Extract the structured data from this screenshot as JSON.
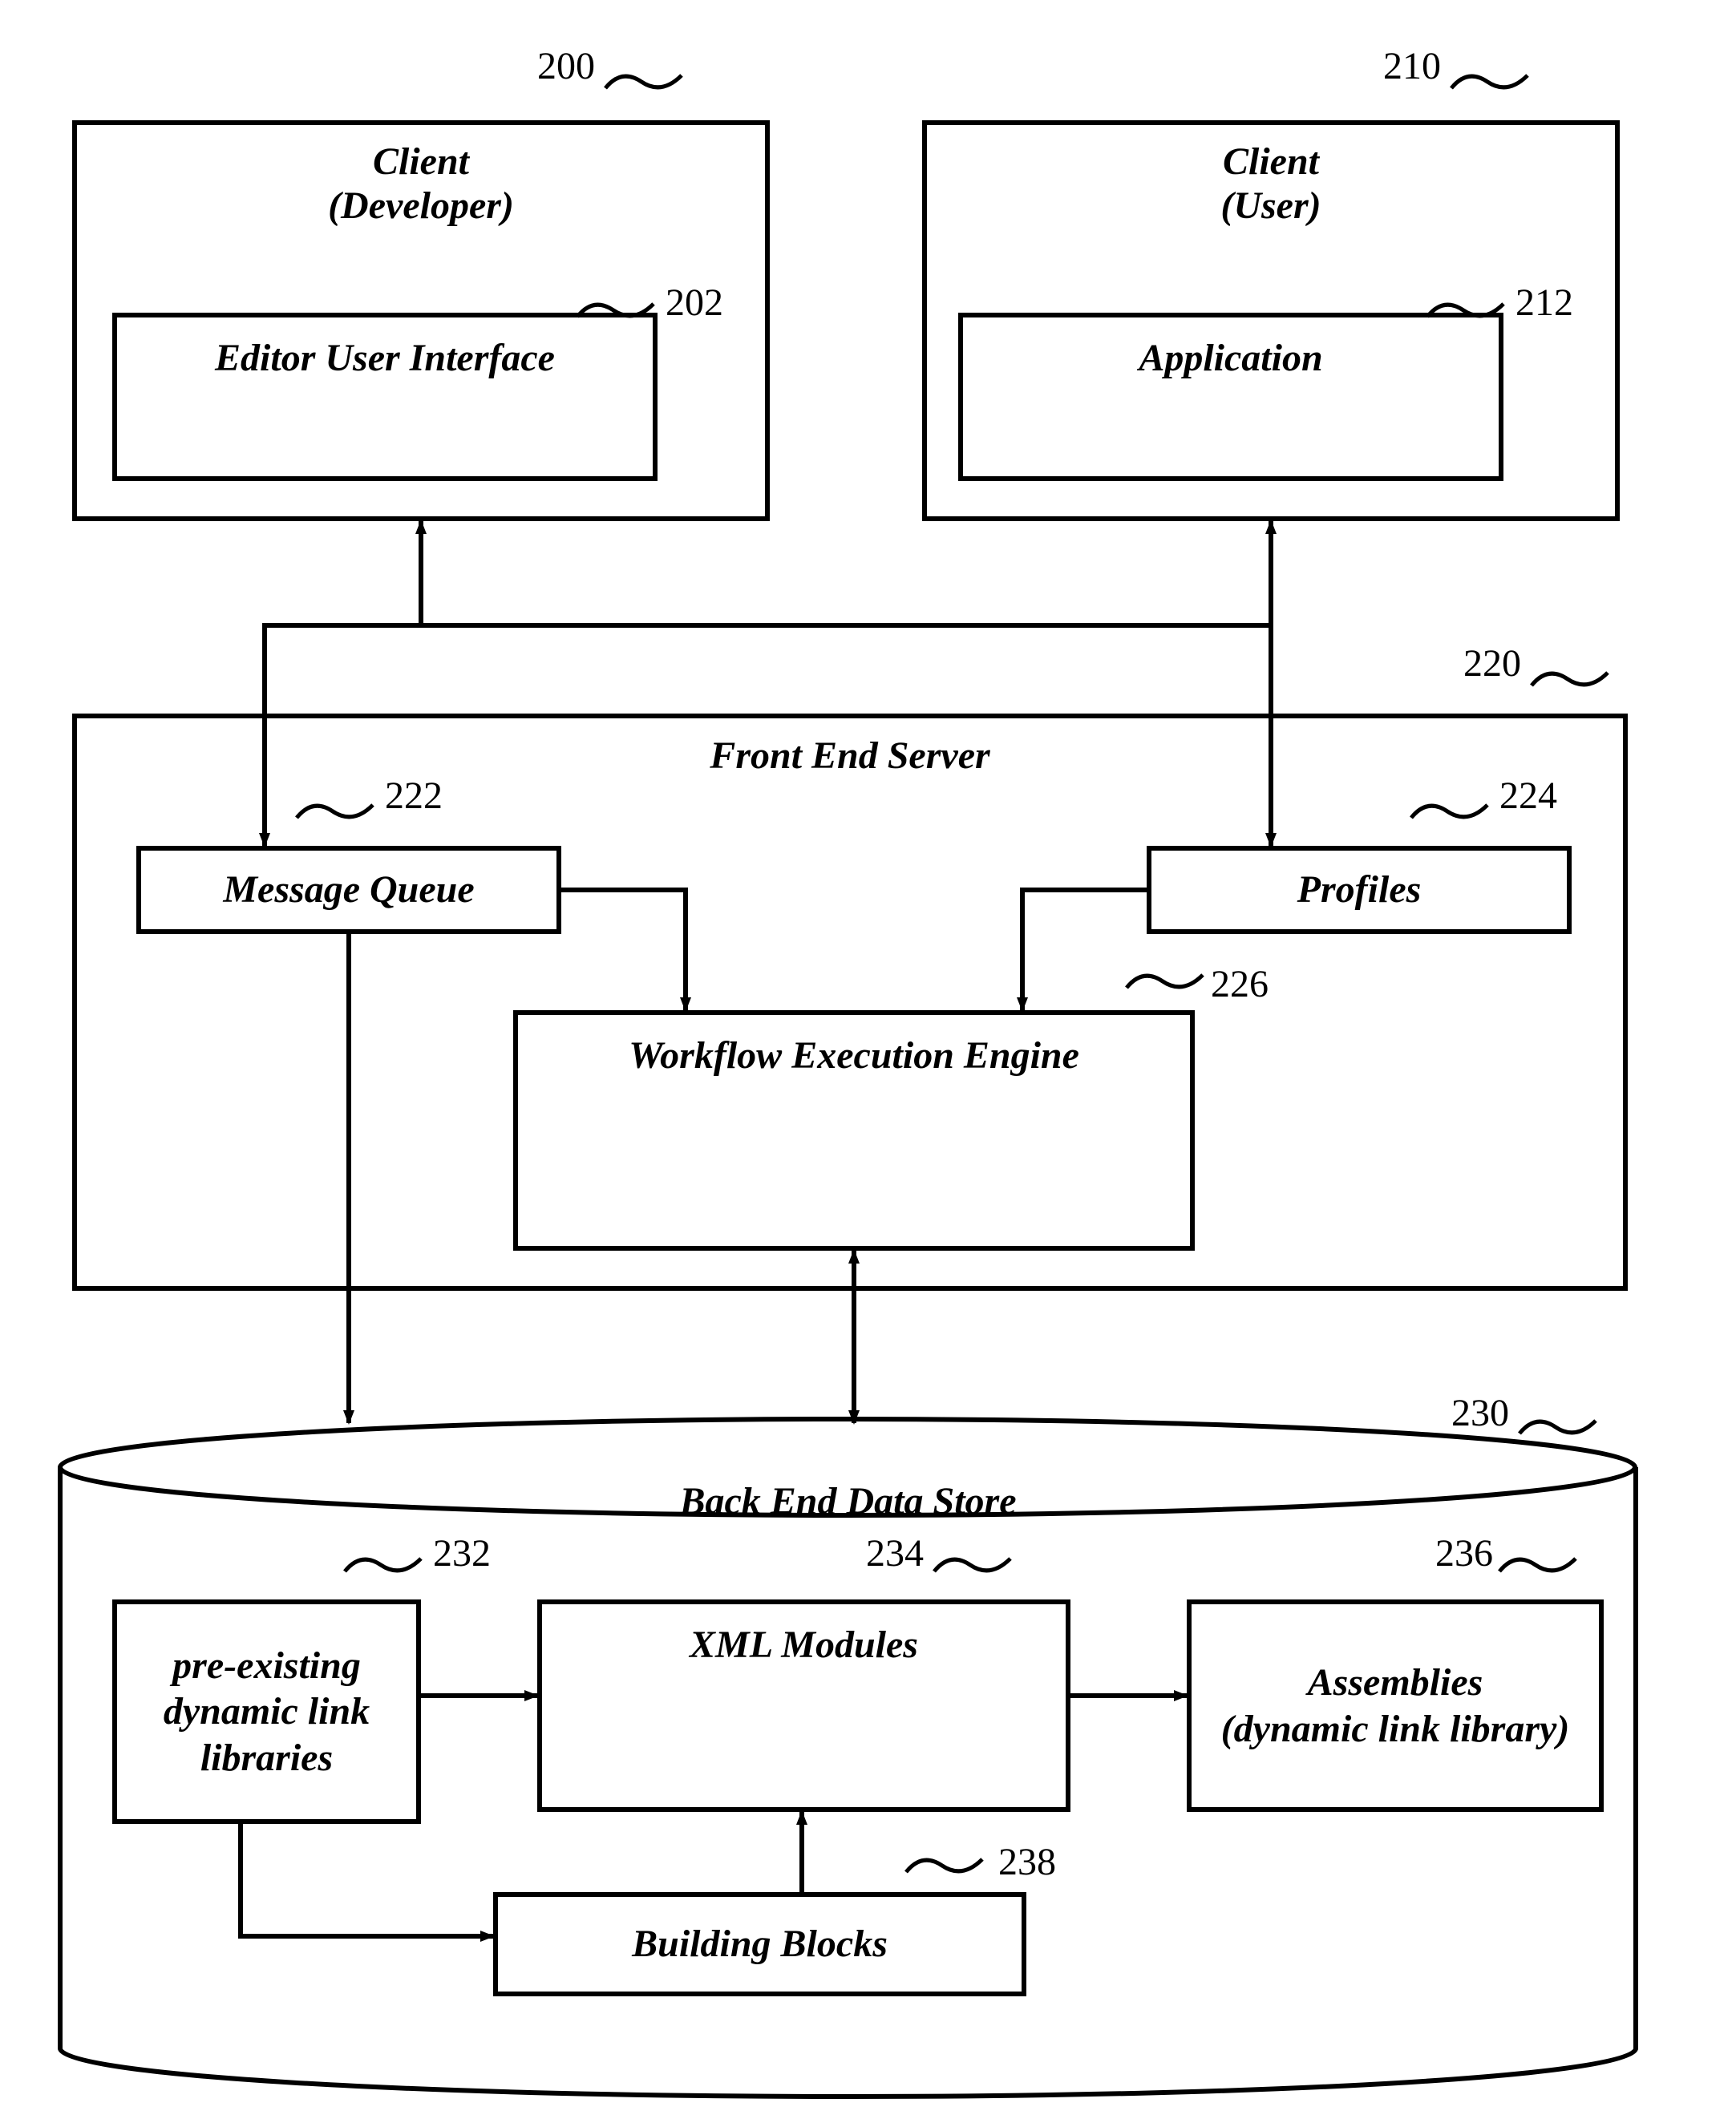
{
  "labels": {
    "n200": "200",
    "n202": "202",
    "n210": "210",
    "n212": "212",
    "n220": "220",
    "n222": "222",
    "n224": "224",
    "n226": "226",
    "n230": "230",
    "n232": "232",
    "n234": "234",
    "n236": "236",
    "n238": "238"
  },
  "boxes": {
    "client_dev_line1": "Client",
    "client_dev_line2": "(Developer)",
    "editor_ui": "Editor User Interface",
    "client_user_line1": "Client",
    "client_user_line2": "(User)",
    "application": "Application",
    "front_end_server": "Front End Server",
    "message_queue": "Message Queue",
    "profiles": "Profiles",
    "workflow_engine": "Workflow Execution Engine",
    "back_end_store": "Back End Data Store",
    "pre_existing_line1": "pre-existing",
    "pre_existing_line2": "dynamic link",
    "pre_existing_line3": "libraries",
    "xml_modules": "XML Modules",
    "assemblies_line1": "Assemblies",
    "assemblies_line2": "(dynamic link library)",
    "building_blocks": "Building Blocks"
  }
}
